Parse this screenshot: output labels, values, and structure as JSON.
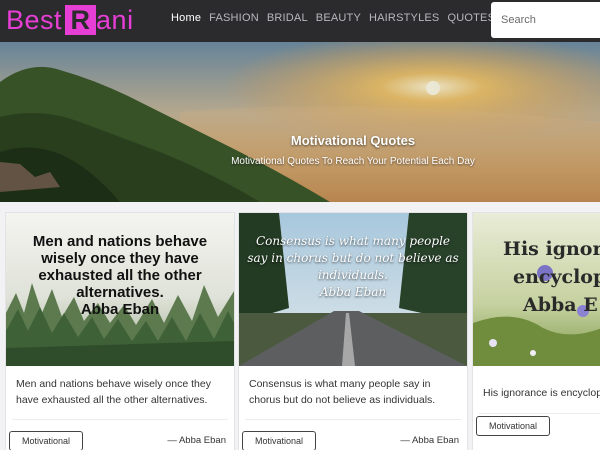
{
  "header": {
    "logo_prefix": "Best",
    "logo_box": "R",
    "logo_suffix": "ani",
    "brand_color": "#e73fd5",
    "nav": [
      {
        "label": "Home",
        "active": true
      },
      {
        "label": "FASHION",
        "active": false
      },
      {
        "label": "BRIDAL",
        "active": false
      },
      {
        "label": "BEAUTY",
        "active": false
      },
      {
        "label": "HAIRSTYLES",
        "active": false
      },
      {
        "label": "QUOTES",
        "active": false
      }
    ],
    "search_placeholder": "Search"
  },
  "hero": {
    "title": "Motivational Quotes",
    "subtitle": "Motivational Quotes To Reach Your Potential Each Day"
  },
  "cards": [
    {
      "image_text": "Men and nations behave wisely once they have exhausted all the other alternatives.",
      "image_author": "Abba Eban",
      "text": "Men and nations behave wisely once they have exhausted all the other alternatives.",
      "tag": "Motivational",
      "author": "— Abba Eban"
    },
    {
      "image_text": "Consensus is what many people say in chorus but do not believe as individuals.",
      "image_author": "Abba Eban",
      "text": "Consensus is what many people say in chorus but do not believe as individuals.",
      "tag": "Motivational",
      "author": "— Abba Eban"
    },
    {
      "image_text_line1": "His ignor",
      "image_text_line2": "encyclop",
      "image_author": "Abba E",
      "text": "His ignorance is encyclope",
      "tag": "Motivational"
    }
  ]
}
